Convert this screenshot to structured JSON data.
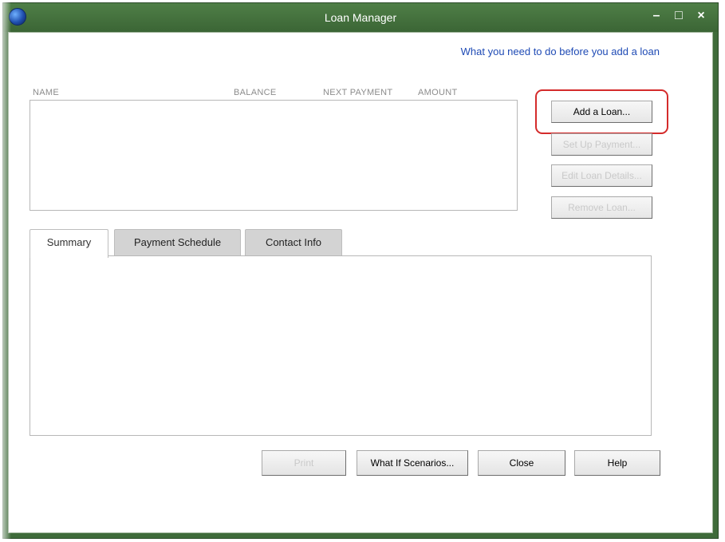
{
  "window": {
    "title": "Loan Manager",
    "controls": {
      "minimize": "–",
      "maximize": "□",
      "close": "×"
    }
  },
  "help_link": "What you need to do before you add a loan",
  "list_columns": [
    "NAME",
    "BALANCE",
    "NEXT PAYMENT",
    "AMOUNT"
  ],
  "side_buttons": {
    "add_loan": "Add a Loan...",
    "set_up_payment": "Set Up Payment...",
    "edit_loan_details": "Edit Loan Details...",
    "remove_loan": "Remove Loan..."
  },
  "tabs": [
    "Summary",
    "Payment Schedule",
    "Contact Info"
  ],
  "active_tab": "Summary",
  "bottom_buttons": {
    "print": "Print",
    "what_if": "What If Scenarios...",
    "close": "Close",
    "help": "Help"
  },
  "colors": {
    "titlebar": "#3f6b3a",
    "link": "#1f4bb5",
    "highlight": "#d42b2b"
  }
}
